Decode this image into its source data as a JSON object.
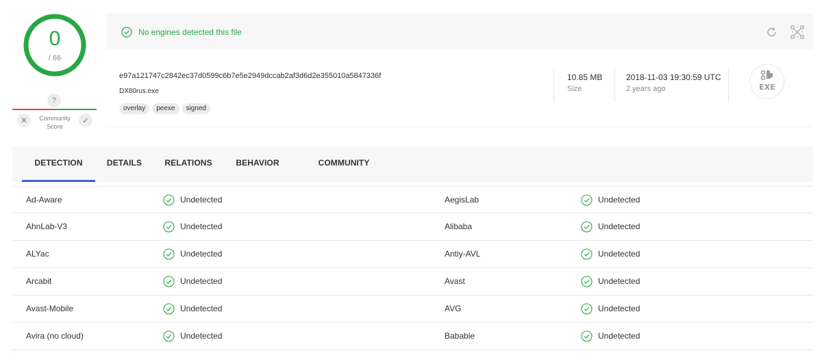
{
  "score": {
    "value": "0",
    "total": "/ 66",
    "ring_color": "#27a745",
    "community": {
      "question_mark": "?",
      "label_line1": "Community",
      "label_line2": "Score",
      "downvote_icon": "x-icon",
      "upvote_icon": "check-icon"
    }
  },
  "banner": {
    "text": "No engines detected this file",
    "status_icon": "check-circle-icon",
    "reload_icon": "reload-icon",
    "expand_icon": "expand-icon",
    "accent": "#27a745"
  },
  "file": {
    "hash": "e97a121747c2842ec37d0599c6b7e5e2949dccab2af3d6d2e355010a5847336f",
    "name": "DX80rus.exe",
    "tags": [
      "overlay",
      "peexe",
      "signed"
    ],
    "size_value": "10.85 MB",
    "size_label": "Size",
    "date_value": "2018-11-03 19:30:59 UTC",
    "date_label": "2 years ago",
    "type_label": "EXE"
  },
  "tabs": [
    {
      "label": "DETECTION",
      "active": true
    },
    {
      "label": "DETAILS",
      "active": false
    },
    {
      "label": "RELATIONS",
      "active": false
    },
    {
      "label": "BEHAVIOR",
      "active": false
    },
    {
      "label": "COMMUNITY",
      "active": false
    }
  ],
  "detections": [
    {
      "left": {
        "engine": "Ad-Aware",
        "result": "Undetected"
      },
      "right": {
        "engine": "AegisLab",
        "result": "Undetected"
      }
    },
    {
      "left": {
        "engine": "AhnLab-V3",
        "result": "Undetected"
      },
      "right": {
        "engine": "Alibaba",
        "result": "Undetected"
      }
    },
    {
      "left": {
        "engine": "ALYac",
        "result": "Undetected"
      },
      "right": {
        "engine": "Antiy-AVL",
        "result": "Undetected"
      }
    },
    {
      "left": {
        "engine": "Arcabit",
        "result": "Undetected"
      },
      "right": {
        "engine": "Avast",
        "result": "Undetected"
      }
    },
    {
      "left": {
        "engine": "Avast-Mobile",
        "result": "Undetected"
      },
      "right": {
        "engine": "AVG",
        "result": "Undetected"
      }
    },
    {
      "left": {
        "engine": "Avira (no cloud)",
        "result": "Undetected"
      },
      "right": {
        "engine": "Babable",
        "result": "Undetected"
      }
    }
  ]
}
